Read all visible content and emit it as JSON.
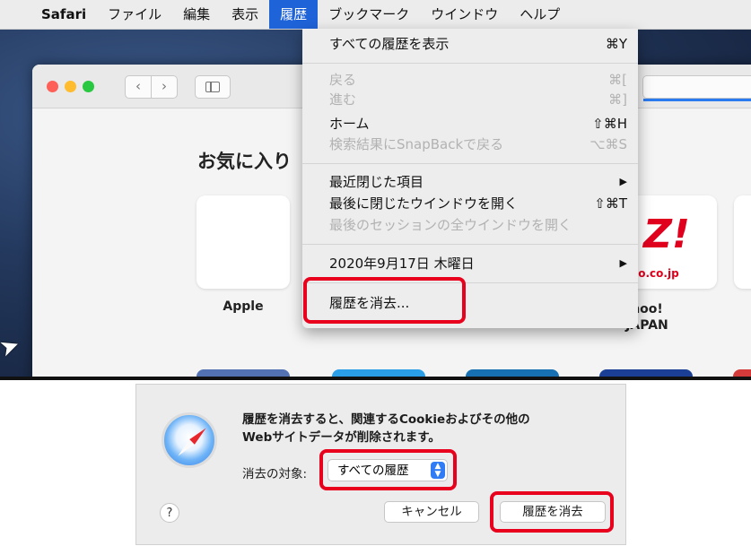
{
  "menubar": {
    "apple_glyph": "",
    "items": [
      "Safari",
      "ファイル",
      "編集",
      "表示",
      "履歴",
      "ブックマーク",
      "ウインドウ",
      "ヘルプ"
    ]
  },
  "safari_window": {
    "favorites_title": "お気に入り",
    "tiles": {
      "apple_label": "Apple",
      "yahoo_mark": "Z!",
      "yahoo_url": "oo.co.jp",
      "yahoo_label_line1": "hoo!",
      "yahoo_label_line2": "JAPAN"
    }
  },
  "history_menu": {
    "show_all": {
      "label": "すべての履歴を表示",
      "shortcut": "⌘Y"
    },
    "back": {
      "label": "戻る",
      "shortcut": "⌘["
    },
    "forward": {
      "label": "進む",
      "shortcut": "⌘]"
    },
    "home": {
      "label": "ホーム",
      "shortcut": "⇧⌘H"
    },
    "snapback": {
      "label": "検索結果にSnapBackで戻る",
      "shortcut": "⌥⌘S"
    },
    "recently_closed": {
      "label": "最近閉じた項目",
      "arrow": "▶"
    },
    "reopen_last_window": {
      "label": "最後に閉じたウインドウを開く",
      "shortcut": "⇧⌘T"
    },
    "reopen_last_session": {
      "label": "最後のセッションの全ウインドウを開く"
    },
    "date_item": {
      "label": "2020年9月17日 木曜日",
      "arrow": "▶"
    },
    "clear_history": {
      "label": "履歴を消去..."
    }
  },
  "dialog": {
    "message_line1": "履歴を消去すると、関連するCookieおよびその他の",
    "message_line2": "Webサイトデータが削除されます。",
    "target_label": "消去の対象:",
    "target_value": "すべての履歴",
    "help_label": "?",
    "cancel_label": "キャンセル",
    "clear_label": "履歴を消去"
  },
  "colors": {
    "highlight": "#e8001c",
    "menu_selected": "#1f63d8",
    "accent_blue": "#2f7cf6"
  }
}
